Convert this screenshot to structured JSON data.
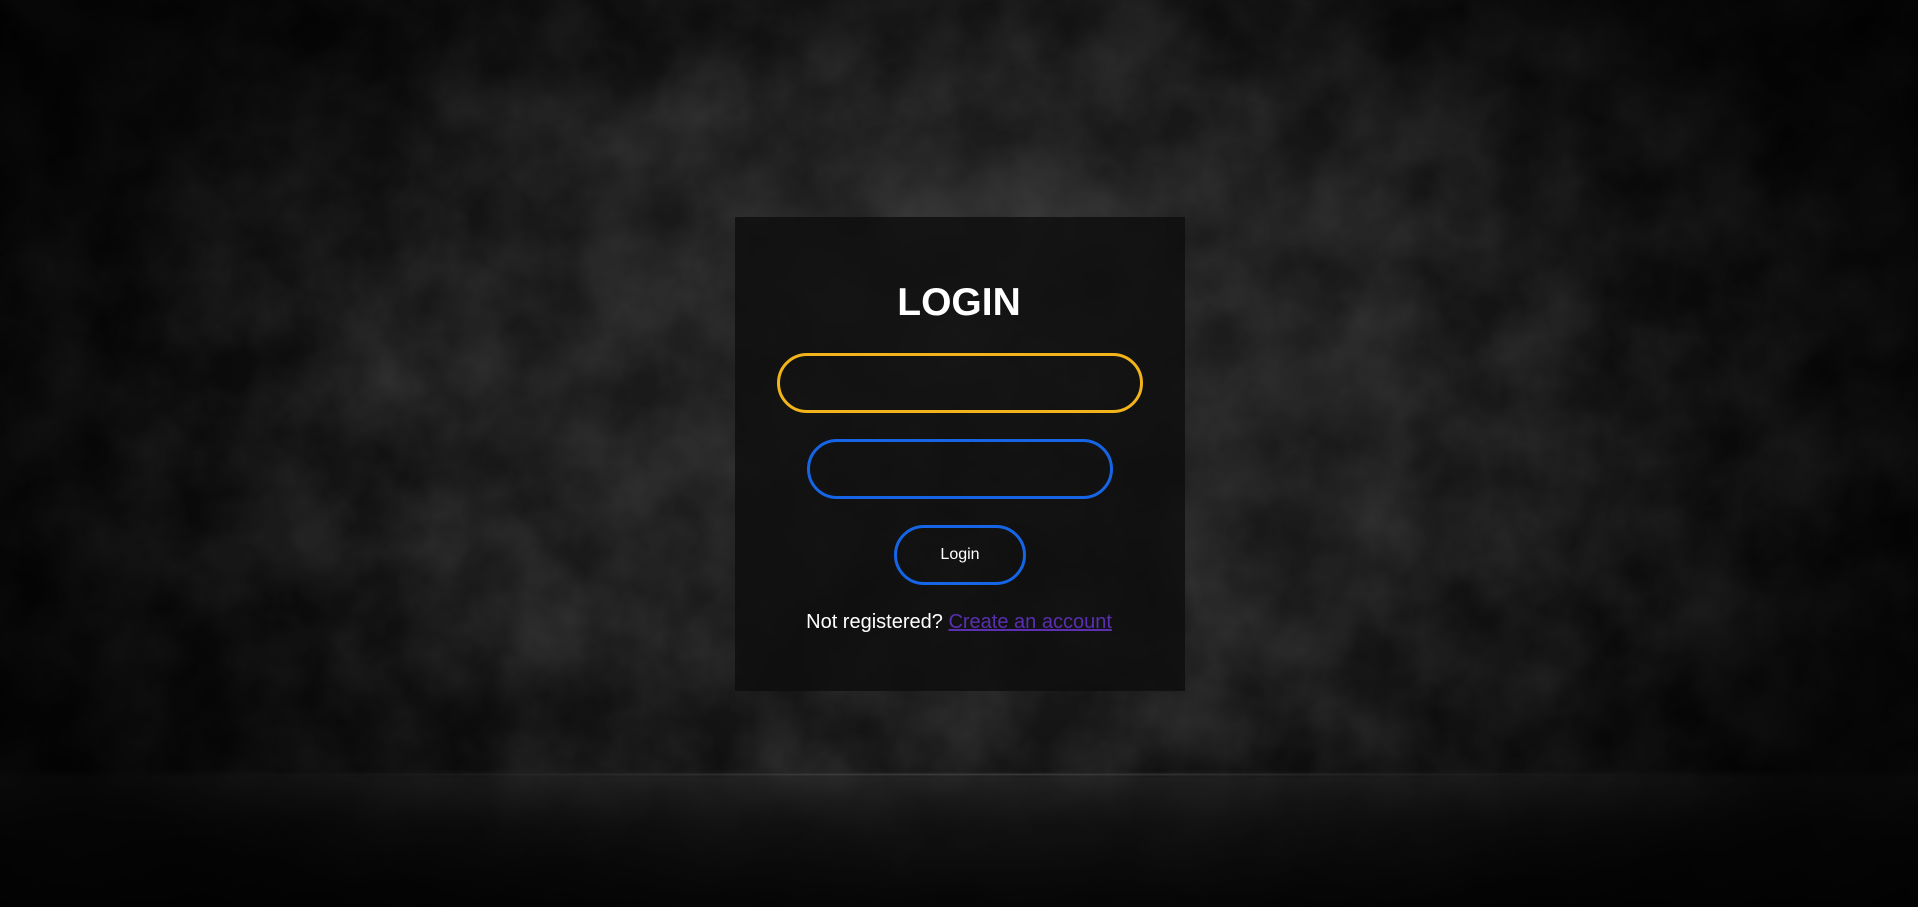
{
  "page": {
    "title": "LOGIN"
  },
  "form": {
    "username": {
      "value": "",
      "placeholder": ""
    },
    "password": {
      "value": "",
      "placeholder": ""
    },
    "login_label": "Login"
  },
  "register": {
    "prompt": "Not registered?",
    "link_label": "Create an account"
  },
  "colors": {
    "username_border": "#f2b41a",
    "password_border": "#1565e6",
    "button_border": "#1565e6",
    "link": "#5a2fb0",
    "text": "#ffffff"
  }
}
